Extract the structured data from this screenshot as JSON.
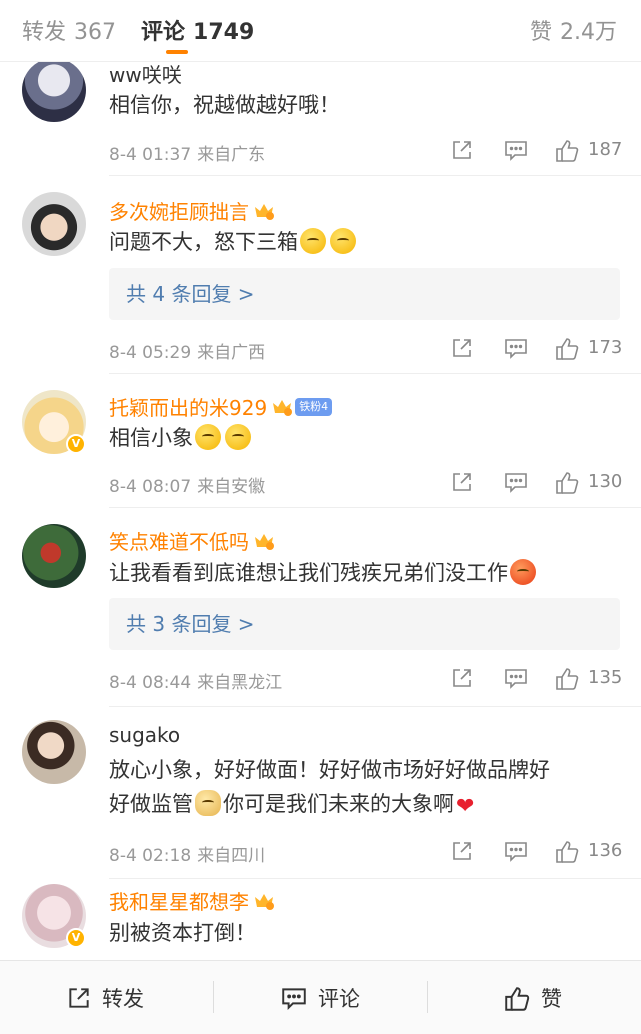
{
  "tabs": {
    "repost": {
      "label": "转发",
      "count": "367"
    },
    "comment": {
      "label": "评论",
      "count": "1749"
    },
    "like": {
      "label": "赞",
      "count": "2.4万"
    }
  },
  "colors": {
    "accent": "#ff8200",
    "link": "#507daf",
    "meta": "#999999"
  },
  "comments": [
    {
      "name": "ww咲咲",
      "text": "相信你，祝越做越好哦！",
      "time": "8-4 01:37",
      "location": "来自广东",
      "likes": "187"
    },
    {
      "name": "多次婉拒顾拙言",
      "text": "问题不大，怒下三箱",
      "replies": "共 4 条回复 >",
      "time": "8-4 05:29",
      "location": "来自广西",
      "likes": "173"
    },
    {
      "name": "托颖而出的米929",
      "fan_badge": "铁粉4",
      "text": "相信小象",
      "time": "8-4 08:07",
      "location": "来自安徽",
      "likes": "130"
    },
    {
      "name": "笑点难道不低吗",
      "text": "让我看看到底谁想让我们残疾兄弟们没工作",
      "replies": "共 3 条回复 >",
      "time": "8-4 08:44",
      "location": "来自黑龙江",
      "likes": "135"
    },
    {
      "name": "sugako",
      "text_line1": "放心小象，好好做面！好好做市场好好做品牌好",
      "text_line2a": "好做监管",
      "text_line2b": "你可是我们未来的大象啊",
      "time": "8-4 02:18",
      "location": "来自四川",
      "likes": "136"
    },
    {
      "name": "我和星星都想李",
      "text": "别被资本打倒！"
    }
  ],
  "bottom_bar": {
    "repost": "转发",
    "comment": "评论",
    "like": "赞"
  },
  "icons": [
    "share-icon",
    "comment-icon",
    "like-icon",
    "crown-badge-icon",
    "verified-badge-icon"
  ]
}
